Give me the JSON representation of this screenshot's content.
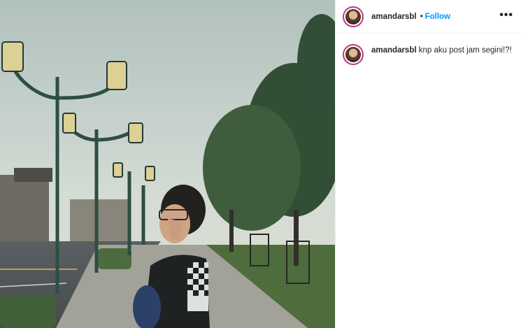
{
  "post": {
    "username": "amandarsbl",
    "separator": "•",
    "follow_label": "Follow",
    "more_label": "•••"
  },
  "caption": {
    "username": "amandarsbl",
    "text": "knp aku post jam segini!?!"
  },
  "icons": {
    "avatar": "profile-avatar",
    "more": "more-options-icon"
  },
  "colors": {
    "follow": "#0095f6",
    "story_ring": "#c13584",
    "text": "#262626"
  }
}
